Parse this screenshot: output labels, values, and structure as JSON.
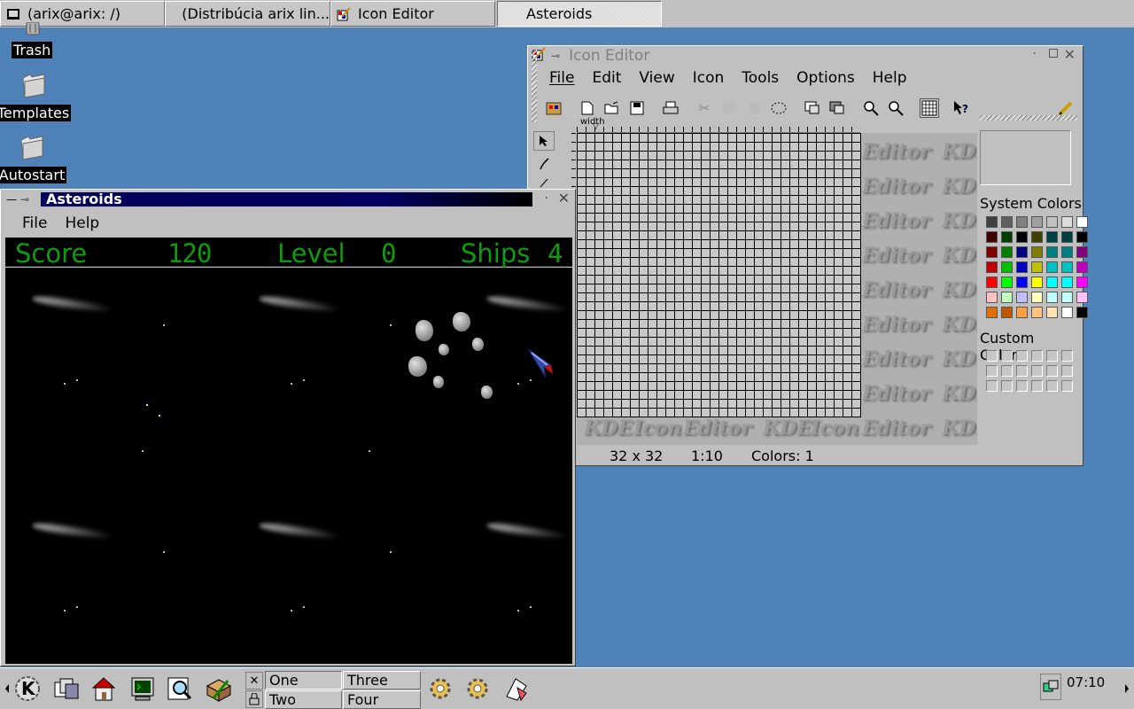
{
  "taskbar": {
    "tasks": [
      {
        "label": "(arix@arix: /)"
      },
      {
        "label": "(Distribúcia arix lin..."
      },
      {
        "label": "Icon Editor"
      },
      {
        "label": "Asteroids"
      }
    ]
  },
  "desktop": {
    "icons": [
      {
        "label": "Trash",
        "icon": "trash-icon"
      },
      {
        "label": "Templates",
        "icon": "folder-icon"
      },
      {
        "label": "Autostart",
        "icon": "folder-icon"
      }
    ]
  },
  "icon_editor": {
    "title": "Icon Editor",
    "menu": [
      "File",
      "Edit",
      "View",
      "Icon",
      "Tools",
      "Options",
      "Help"
    ],
    "ruler_label": "width",
    "watermark_kde": "KDE",
    "watermark_icon": "Icon",
    "watermark_editor": "Editor",
    "system_colors_label": "System Colors",
    "custom_colors_label": "Custom Colors",
    "system_colors": [
      "#404040",
      "#606060",
      "#808080",
      "#a0a0a0",
      "#c0c0c0",
      "#dcdcdc",
      "#ffffff",
      "#400000",
      "#004000",
      "#000000",
      "#404000",
      "#004040",
      "#004040",
      "#000000",
      "#800000",
      "#008000",
      "#000080",
      "#808000",
      "#008080",
      "#008080",
      "#800080",
      "#c00000",
      "#00c000",
      "#0000c0",
      "#c0c000",
      "#00c0c0",
      "#00c0c0",
      "#c000c0",
      "#ff0000",
      "#00ff00",
      "#0000ff",
      "#ffff00",
      "#00ffff",
      "#00ffff",
      "#ff00ff",
      "#ffc0c0",
      "#c0ffc0",
      "#c0c0ff",
      "#ffffc0",
      "#c0ffff",
      "#c0ffff",
      "#ffc0ff",
      "#e07000",
      "#c05800",
      "#ffa040",
      "#ffc080",
      "#ffe0b0",
      "#ffffff",
      "#000000"
    ],
    "status": {
      "size": "32 x 32",
      "zoom": "1:10",
      "colors": "Colors: 1"
    }
  },
  "asteroids": {
    "title": "Asteroids",
    "menu": [
      "File",
      "Help"
    ],
    "score_label": "Score",
    "score_value": "120",
    "level_label": "Level",
    "level_value": "0",
    "ships_label": "Ships",
    "ships_value": "4"
  },
  "panel": {
    "desktops": [
      "One",
      "Two",
      "Three",
      "Four"
    ],
    "clock": "07:10"
  }
}
